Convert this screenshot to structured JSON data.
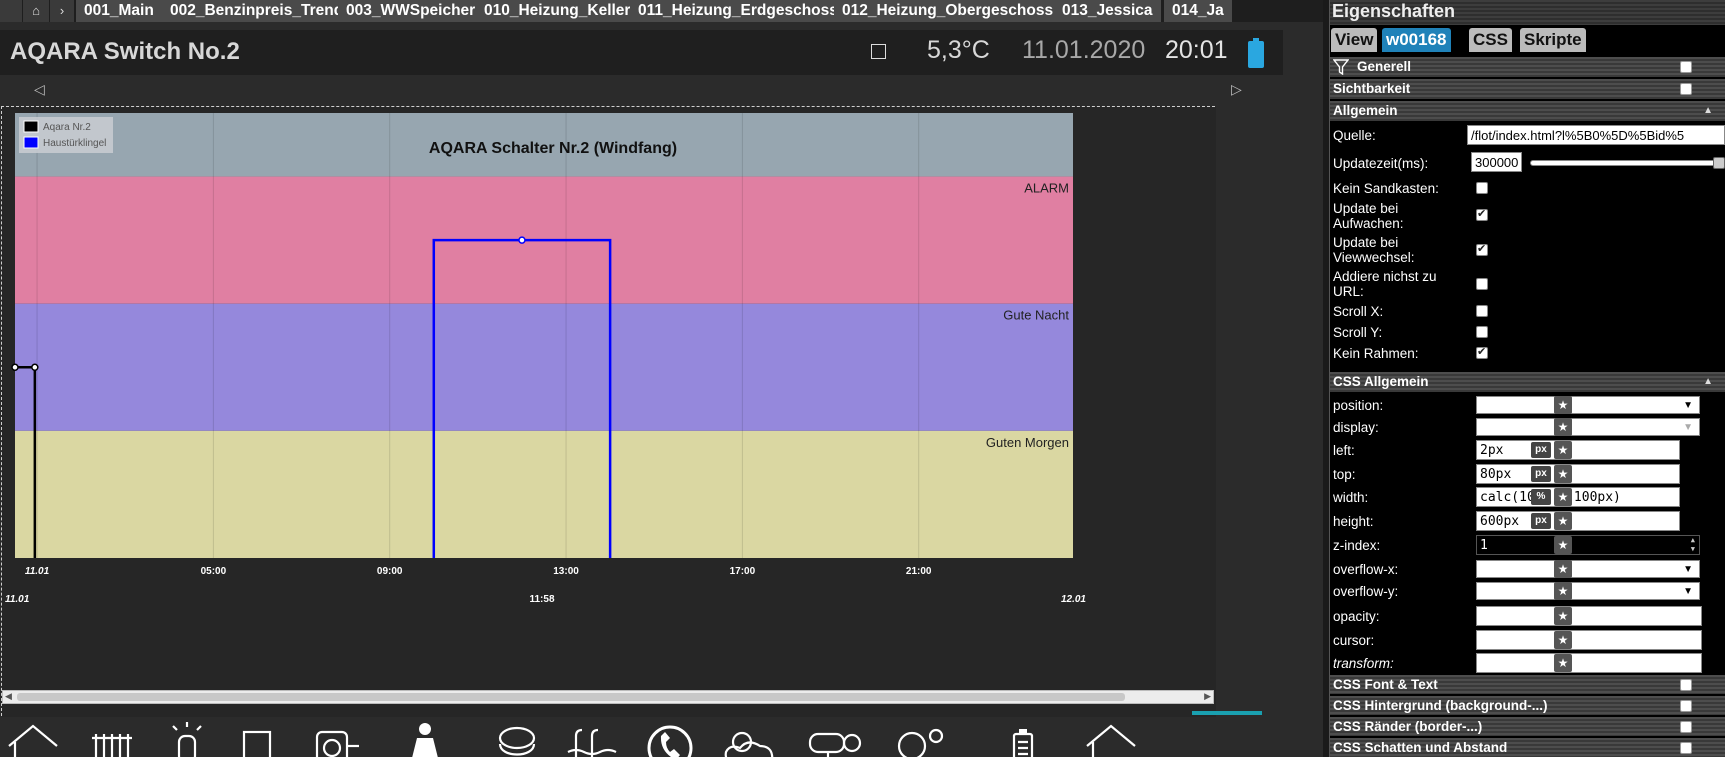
{
  "tabbar": {
    "home_btn": "⌂",
    "next_btn": "›",
    "tabs": [
      {
        "label": "001_Main"
      },
      {
        "label": "002_Benzinpreis_Trend"
      },
      {
        "label": "003_WWSpeicher"
      },
      {
        "label": "010_Heizung_Keller"
      },
      {
        "label": "011_Heizung_Erdgeschoss"
      },
      {
        "label": "012_Heizung_Obergeschoss"
      },
      {
        "label": "013_Jessica"
      },
      {
        "label": "014_Ja"
      }
    ]
  },
  "header": {
    "title": "AQARA Switch No.2",
    "temperature": "5,3°C",
    "date": "11.01.2020",
    "time": "20:01"
  },
  "chart_data": {
    "type": "line",
    "title": "AQARA Schalter Nr.2 (Windfang)",
    "legend": [
      {
        "name": "Aqara Nr.2",
        "color": "#000000"
      },
      {
        "name": "Haustürklingel",
        "color": "#0000ff"
      }
    ],
    "legend_position": "top-left",
    "bands": [
      {
        "label": "",
        "from": 3,
        "to": 4,
        "color": "#97a6b0"
      },
      {
        "label": "ALARM",
        "from": 2,
        "to": 3,
        "color": "#e07fa2"
      },
      {
        "label": "Gute Nacht",
        "from": 1,
        "to": 2,
        "color": "#9588dc"
      },
      {
        "label": "Guten Morgen",
        "from": 0,
        "to": 1,
        "color": "#dad7a2"
      }
    ],
    "ylim": [
      0,
      3.5
    ],
    "x_start": "11.01 00:30",
    "x_end": "12.01 00:30",
    "x_ticks": [
      "11.01",
      "05:00",
      "09:00",
      "13:00",
      "17:00",
      "21:00"
    ],
    "x_tick_hours": [
      0.5,
      5,
      9,
      13,
      17,
      21
    ],
    "nav_labels": {
      "left": "11.01",
      "center": "11:58",
      "right": "12.01"
    },
    "series": [
      {
        "name": "Aqara Nr.2",
        "color": "#000000",
        "points": [
          [
            0.5,
            1.5
          ],
          [
            0.95,
            1.5
          ],
          [
            0.95,
            0
          ]
        ]
      },
      {
        "name": "Haustürklingel",
        "color": "#0000ff",
        "points": [
          [
            10,
            0
          ],
          [
            10,
            2.5
          ],
          [
            12,
            2.5
          ],
          [
            14,
            2.5
          ],
          [
            14,
            0
          ]
        ]
      }
    ]
  },
  "bottom_icons": [
    "house-icon",
    "radiator-icon",
    "lightbulb-icon",
    "door-icon",
    "socket-icon",
    "person-icon",
    "robot-vacuum-icon",
    "pool-icon",
    "phone-icon",
    "weather-icon",
    "camera-icon",
    "tree-sun-icon",
    "battery-icon",
    "house-icon"
  ],
  "panel": {
    "title": "Eigenschaften",
    "tabs": [
      {
        "label": "View"
      },
      {
        "label": "w00168"
      },
      {
        "label": "CSS"
      },
      {
        "label": "Skripte"
      }
    ],
    "sections": {
      "generell": "Generell",
      "sichtbarkeit": "Sichtbarkeit",
      "allgemein": "Allgemein",
      "css_allgemein": "CSS Allgemein",
      "css_font": "CSS Font & Text",
      "css_hintergrund": "CSS Hintergrund (background-...)",
      "css_raender": "CSS Ränder (border-...)",
      "css_schatten": "CSS Schatten und Abstand"
    },
    "allgemein": {
      "quelle_label": "Quelle:",
      "quelle_value": "/flot/index.html?l%5B0%5D%5Bid%5",
      "updatezeit_label": "Updatezeit(ms):",
      "updatezeit_value": "300000",
      "kein_sandkasten": "Kein Sandkasten:",
      "update_aufwachen": "Update bei Aufwachen:",
      "update_viewwechsel": "Update bei Viewwechsel:",
      "addiere_url": "Addiere nichst zu URL:",
      "scroll_x": "Scroll X:",
      "scroll_y": "Scroll Y:",
      "kein_rahmen": "Kein Rahmen:"
    },
    "css": {
      "position": "position:",
      "display": "display:",
      "left": "left:",
      "left_value": "2px",
      "top": "top:",
      "top_value": "80px",
      "width": "width:",
      "width_value": "calc(100% - 100px)",
      "height": "height:",
      "height_value": "600px",
      "zindex": "z-index:",
      "zindex_value": "1",
      "overflowx": "overflow-x:",
      "overflowy": "overflow-y:",
      "opacity": "opacity:",
      "cursor": "cursor:",
      "transform": "transform:",
      "unit_px": "px",
      "unit_pct": "%"
    }
  }
}
